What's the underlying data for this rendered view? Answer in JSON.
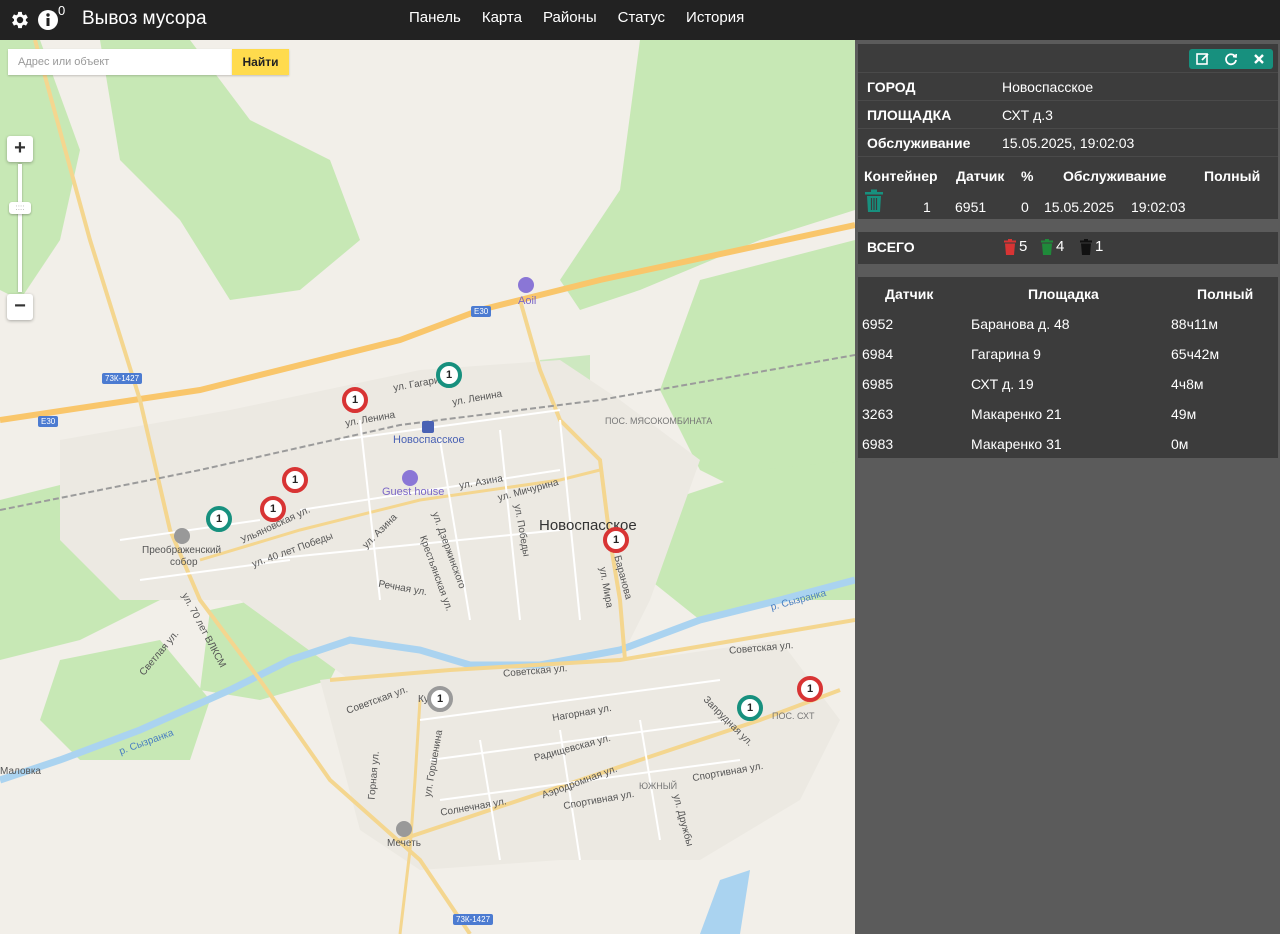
{
  "header": {
    "title": "Вывоз мусора",
    "notification_count": "0",
    "nav": [
      "Панель",
      "Карта",
      "Районы",
      "Статус",
      "История"
    ]
  },
  "search": {
    "placeholder": "Адрес или объект",
    "button": "Найти"
  },
  "map": {
    "labels": {
      "city": "Новоспасское",
      "station": "Новоспасское",
      "meat_plant": "ПОС. МЯСОКОМБИНАТА",
      "guest_house": "Guest house",
      "cathedral_1": "Преображенский",
      "cathedral_2": "собор",
      "aoil": "Aoil",
      "mosque": "Мечеть",
      "malovka": "Маловка",
      "south": "ЮЖНЫЙ",
      "pos_skht": "ПОС. СХТ",
      "river_1": "р. Сызранка",
      "river_2": "р. Сызранка",
      "st_lenina_1": "ул. Ленина",
      "st_lenina_2": "ул. Ленина",
      "st_gagarina": "ул. Гагарина",
      "st_azina_1": "ул. Азина",
      "st_azina_2": "ул. Азина",
      "st_michurina": "ул. Мичурина",
      "st_pobedy": "ул. Победы",
      "st_mira": "ул. Мира",
      "st_baranova": "Баранова",
      "st_dzerzhinskogo": "ул. Дзержинского",
      "st_krestyanskaya": "Крестьянская ул.",
      "st_rechnaya": "Речная ул.",
      "st_ulyanovskaya": "Ульяновская ул.",
      "st_40let": "ул. 40 лет Победы",
      "st_70let": "ул. 70 лет ВЛКСМ",
      "st_svetlaya": "Светлая ул.",
      "st_sovetskaya_1": "Советская ул.",
      "st_sovetskaya_2": "Советская ул.",
      "st_sovetskaya_3": "Советская ул.",
      "st_nagornaya": "Нагорная ул.",
      "st_radishchevskaya": "Радищевская ул.",
      "st_aerodromnaya": "Аэродромная ул.",
      "st_sportivnaya_1": "Спортивная ул.",
      "st_sportivnaya_2": "Спортивная ул.",
      "st_solnechnaya": "Солнечная ул.",
      "st_gorshenina": "ул. Горшенина",
      "st_gornaya": "Горная ул.",
      "st_druzhby": "ул. Дружбы",
      "st_zaprudnaya": "Запрудная ул.",
      "st_ku": "Ку"
    },
    "road_badges": [
      "73К-1427",
      "E30",
      "E30",
      "73К-1427"
    ],
    "markers": [
      {
        "count": "1",
        "status": "green"
      },
      {
        "count": "1",
        "status": "red"
      },
      {
        "count": "1",
        "status": "red"
      },
      {
        "count": "1",
        "status": "red"
      },
      {
        "count": "1",
        "status": "green"
      },
      {
        "count": "1",
        "status": "red"
      },
      {
        "count": "1",
        "status": "gray"
      },
      {
        "count": "1",
        "status": "green"
      },
      {
        "count": "1",
        "status": "red"
      }
    ]
  },
  "details": {
    "city_label": "ГОРОД",
    "city_value": "Новоспасское",
    "site_label": "ПЛОЩАДКА",
    "site_value": "СХТ д.3",
    "service_label": "Обслуживание",
    "service_value": "15.05.2025, 19:02:03",
    "container_headers": [
      "Контейнер",
      "Датчик",
      "%",
      "Обслуживание",
      "Полный"
    ],
    "container_row": {
      "container": "1",
      "sensor": "6951",
      "percent": "0",
      "date": "15.05.2025",
      "time": "19:02:03"
    }
  },
  "totals": {
    "label": "ВСЕГО",
    "red": "5",
    "green": "4",
    "black": "1"
  },
  "sensor_table": {
    "headers": [
      "Датчик",
      "Площадка",
      "Полный"
    ],
    "rows": [
      {
        "sensor": "6952",
        "site": "Баранова д. 48",
        "full": "88ч11м"
      },
      {
        "sensor": "6984",
        "site": "Гагарина 9",
        "full": "65ч42м"
      },
      {
        "sensor": "6985",
        "site": "СХТ д. 19",
        "full": "4ч8м"
      },
      {
        "sensor": "3263",
        "site": "Макаренко 21",
        "full": "49м"
      },
      {
        "sensor": "6983",
        "site": "Макаренко 31",
        "full": "0м"
      }
    ]
  },
  "colors": {
    "accent": "#17907e",
    "red": "#d83434",
    "gray": "#9a9a9a",
    "topbar": "#222222",
    "panel": "#3c3c3c"
  }
}
